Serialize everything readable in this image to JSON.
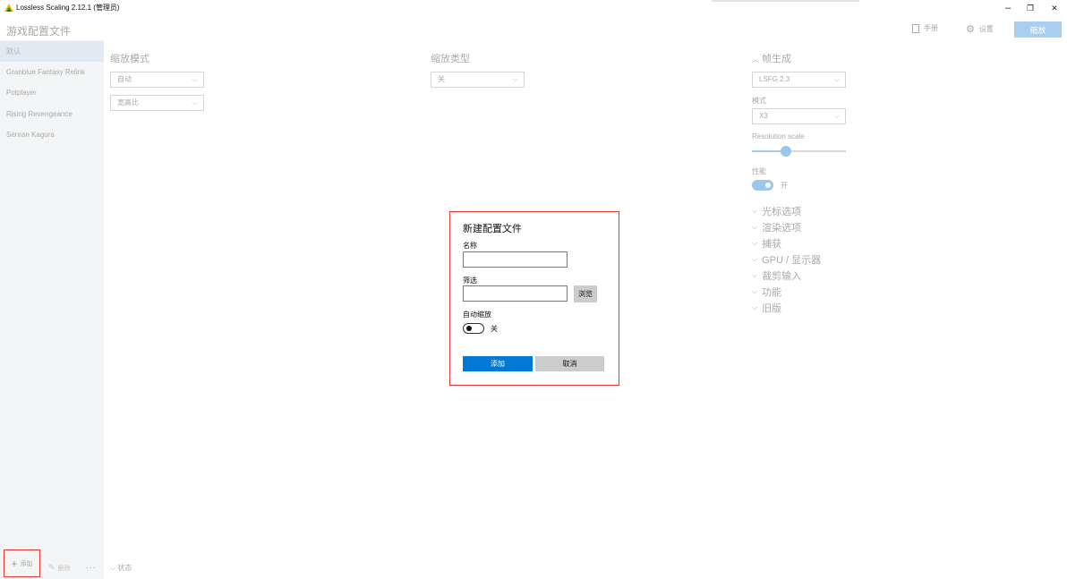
{
  "window": {
    "title": "Lossless Scaling 2.12.1 (管理员)",
    "minimize_glyph": "–",
    "restore_glyph": "❐",
    "close_glyph": "✕"
  },
  "header": {
    "page_title": "游戏配置文件",
    "manual_label": "手册",
    "settings_label": "设置",
    "scale_button": "缩放"
  },
  "sidebar": {
    "items": [
      {
        "label": "默认",
        "active": true
      },
      {
        "label": "Granblue Fantasy Relink"
      },
      {
        "label": "Potplayer"
      },
      {
        "label": "Rising Revengeance"
      },
      {
        "label": "Senran Kagura"
      }
    ],
    "add_label": "添加",
    "delete_label": "删除",
    "more_label": "..."
  },
  "main": {
    "scale_mode_title": "缩放模式",
    "scale_mode_value": "自动",
    "aspect_value": "宽高比",
    "scale_type_title": "缩放类型",
    "scale_type_value": "关",
    "status_label": "状态"
  },
  "frame_gen": {
    "title": "帧生成",
    "type_value": "LSFG 2.3",
    "mode_label": "模式",
    "mode_value": "X3",
    "resolution_scale_label": "Resolution scale",
    "resolution_scale_fraction": 0.36,
    "performance_label": "性能",
    "performance_state": "开",
    "sections": [
      "光标选项",
      "渲染选项",
      "捕获",
      "GPU / 显示器",
      "裁剪输入",
      "功能",
      "旧版"
    ]
  },
  "dialog": {
    "title": "新建配置文件",
    "name_label": "名称",
    "name_value": "",
    "filter_label": "筛选",
    "filter_value": "",
    "browse_label": "浏览",
    "auto_scale_label": "自动缩放",
    "auto_scale_state": "关",
    "add_button": "添加",
    "cancel_button": "取消"
  },
  "colors": {
    "accent": "#0078d4",
    "highlight_frame": "#e53935",
    "disabled_accent": "#a9cff0"
  }
}
